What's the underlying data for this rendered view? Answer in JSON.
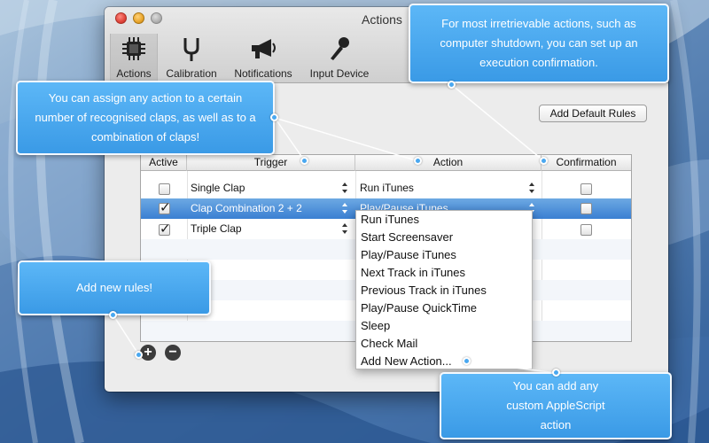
{
  "window": {
    "title": "Actions"
  },
  "toolbar": {
    "items": [
      {
        "label": "Actions",
        "icon": "chip-icon",
        "active": true
      },
      {
        "label": "Calibration",
        "icon": "tuning-fork-icon",
        "active": false
      },
      {
        "label": "Notifications",
        "icon": "megaphone-icon",
        "active": false
      },
      {
        "label": "Input Device",
        "icon": "microphone-icon",
        "active": false
      }
    ]
  },
  "add_default_rules_label": "Add Default Rules",
  "table": {
    "headers": [
      "Active",
      "Trigger",
      "Action",
      "Confirmation"
    ],
    "rows": [
      {
        "active": false,
        "trigger": "Single Clap",
        "action": "Run iTunes",
        "confirmation": false,
        "selected": false
      },
      {
        "active": true,
        "trigger": "Clap Combination 2 + 2",
        "action": "Play/Pause iTunes",
        "confirmation": false,
        "selected": true
      },
      {
        "active": true,
        "trigger": "Triple Clap",
        "action": "",
        "confirmation": false,
        "selected": false
      }
    ]
  },
  "action_menu": {
    "items": [
      "Run iTunes",
      "Start Screensaver",
      "Play/Pause iTunes",
      "Next Track in iTunes",
      "Previous Track in iTunes",
      "Play/Pause QuickTime",
      "Sleep",
      "Check Mail",
      "Add New Action..."
    ]
  },
  "buttons": {
    "add": "+",
    "remove": "−"
  },
  "callouts": {
    "confirmation": "For most irretrievable actions, such as computer shutdown, you can set up an execution confirmation.",
    "claps": "You can assign any action to a certain number of recognised claps, as well as to a combination of claps!",
    "add_rules": "Add new rules!",
    "applescript": "You can add any custom AppleScript action"
  },
  "colors": {
    "callout": "#4aa8f0",
    "selection": "#3a7fd2",
    "window": "#ececec"
  }
}
